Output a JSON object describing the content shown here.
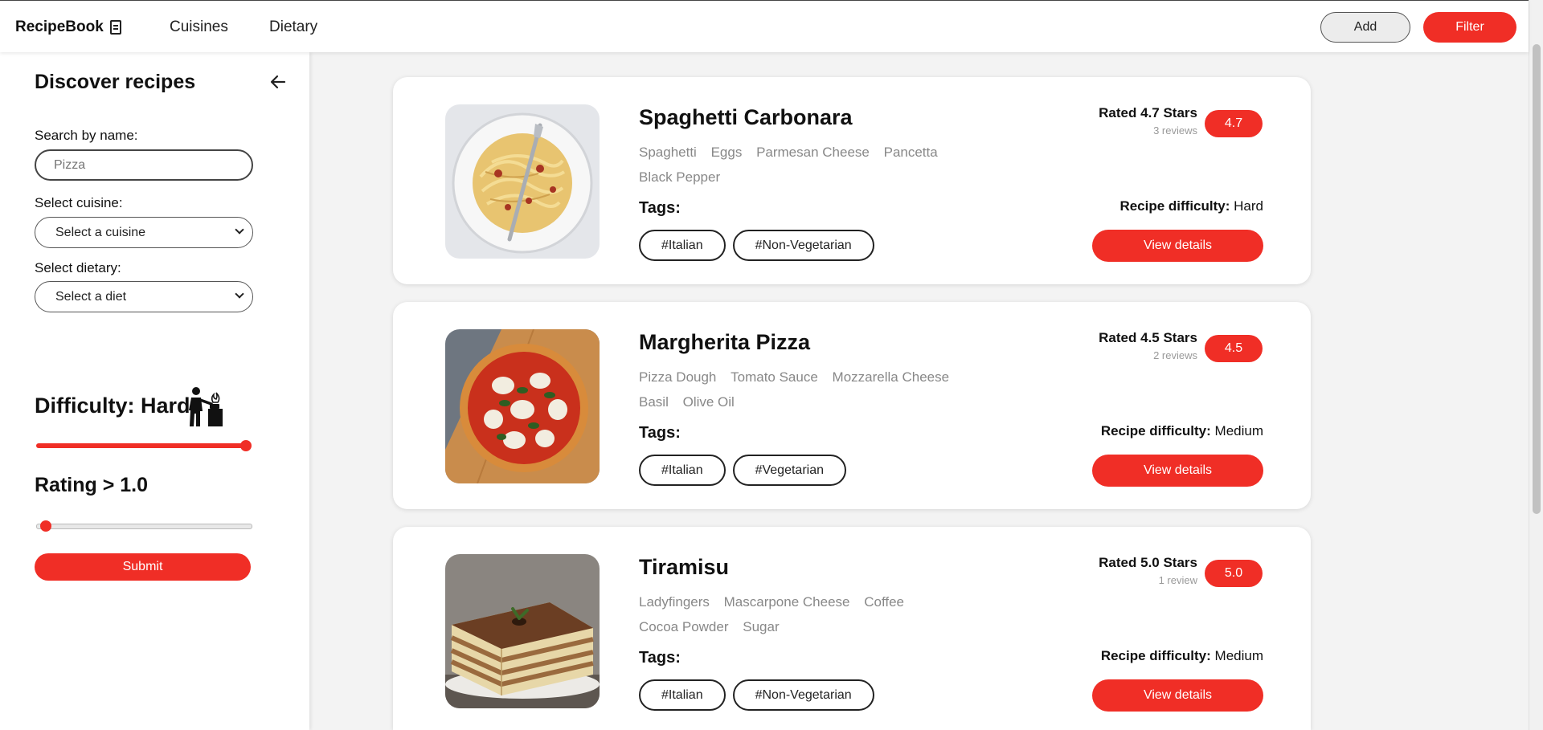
{
  "nav": {
    "brand": "RecipeBook",
    "links": [
      "Cuisines",
      "Dietary"
    ],
    "add_label": "Add",
    "filter_label": "Filter"
  },
  "sidebar": {
    "title": "Discover recipes",
    "search_label": "Search by name:",
    "search_placeholder": "Pizza",
    "cuisine_label": "Select cuisine:",
    "cuisine_value": "Select a cuisine",
    "dietary_label": "Select dietary:",
    "dietary_value": "Select a diet",
    "difficulty_text": "Difficulty: Hard",
    "difficulty_level": 1.0,
    "rating_text": "Rating > 1.0",
    "rating_level": 0.0,
    "submit_label": "Submit"
  },
  "recipes": [
    {
      "name": "Spaghetti Carbonara",
      "ingredients": [
        "Spaghetti",
        "Eggs",
        "Parmesan Cheese",
        "Pancetta",
        "Black Pepper"
      ],
      "tags_label": "Tags:",
      "tags": [
        "#Italian",
        "#Non-Vegetarian"
      ],
      "rated": "Rated 4.7 Stars",
      "reviews": "3 reviews",
      "badge": "4.7",
      "difficulty_label": "Recipe difficulty:",
      "difficulty": "Hard",
      "details_label": "View details"
    },
    {
      "name": "Margherita Pizza",
      "ingredients": [
        "Pizza Dough",
        "Tomato Sauce",
        "Mozzarella Cheese",
        "Basil",
        "Olive Oil"
      ],
      "tags_label": "Tags:",
      "tags": [
        "#Italian",
        "#Vegetarian"
      ],
      "rated": "Rated 4.5 Stars",
      "reviews": "2 reviews",
      "badge": "4.5",
      "difficulty_label": "Recipe difficulty:",
      "difficulty": "Medium",
      "details_label": "View details"
    },
    {
      "name": "Tiramisu",
      "ingredients": [
        "Ladyfingers",
        "Mascarpone Cheese",
        "Coffee",
        "Cocoa Powder",
        "Sugar"
      ],
      "tags_label": "Tags:",
      "tags": [
        "#Italian",
        "#Non-Vegetarian"
      ],
      "rated": "Rated 5.0 Stars",
      "reviews": "1 review",
      "badge": "5.0",
      "difficulty_label": "Recipe difficulty:",
      "difficulty": "Medium",
      "details_label": "View details"
    }
  ],
  "colors": {
    "accent": "#f02e26",
    "panel": "#ffffff",
    "background": "#f3f3f3"
  },
  "icons": [
    "book-icon",
    "arrow-left-icon",
    "cooking-person-icon",
    "chevron-down-icon"
  ]
}
